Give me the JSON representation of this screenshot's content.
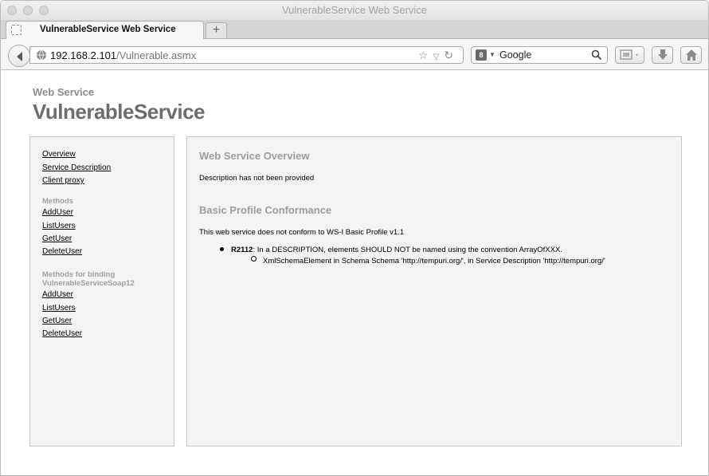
{
  "window": {
    "title": "VulnerableService Web Service"
  },
  "tabs": [
    {
      "label": "VulnerableService Web Service"
    }
  ],
  "new_tab_label": "+",
  "address_bar": {
    "host": "192.168.2.101",
    "path": "/Vulnerable.asmx"
  },
  "search": {
    "engine_icon_text": "8",
    "placeholder": "Google"
  },
  "page": {
    "subtitle": "Web Service",
    "title": "VulnerableService",
    "sidebar": {
      "links": [
        "Overview",
        "Service Description",
        "Client proxy"
      ],
      "methods_heading": "Methods",
      "methods": [
        "AddUser",
        "ListUsers",
        "GetUser",
        "DeleteUser"
      ],
      "binding_heading_line1": "Methods for binding",
      "binding_heading_line2": "VulnerableServiceSoap12",
      "binding_methods": [
        "AddUser",
        "ListUsers",
        "GetUser",
        "DeleteUser"
      ]
    },
    "overview": {
      "title": "Web Service Overview",
      "description": "Description has not been provided"
    },
    "conformance": {
      "title": "Basic Profile Conformance",
      "summary": "This web service does not conform to WS-I Basic Profile v1.1",
      "rule_id": "R2112",
      "rule_text": ": In a DESCRIPTION, elements SHOULD NOT be named using the convention ArrayOfXXX.",
      "detail": "XmlSchemaElement in Schema Schema 'http://tempuri.org/', in Service Description 'http://tempuri.org/'"
    }
  },
  "icons": [
    "back-arrow-icon",
    "globe-icon",
    "bookmark-star-icon",
    "dropdown-icon",
    "reload-icon",
    "search-icon",
    "screenshot-icon",
    "download-icon",
    "home-icon",
    "tab-page-icon"
  ]
}
